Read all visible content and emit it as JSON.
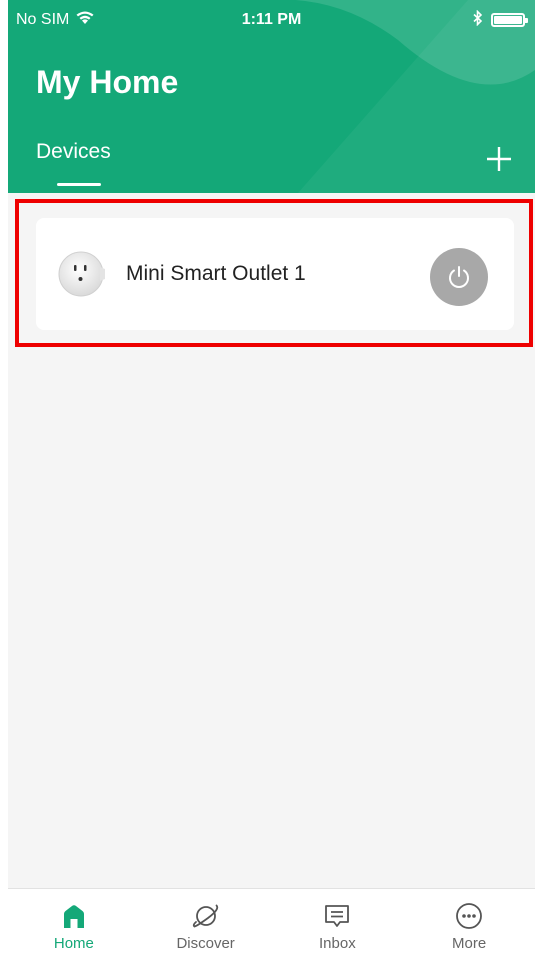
{
  "status_bar": {
    "carrier": "No SIM",
    "time": "1:11 PM",
    "bluetooth_icon": "bluetooth-icon",
    "battery_icon": "battery-icon",
    "wifi_icon": "wifi-icon"
  },
  "header": {
    "title": "My Home",
    "tabs": [
      {
        "label": "Devices",
        "active": true
      }
    ],
    "add_icon": "plus-icon"
  },
  "devices": [
    {
      "name": "Mini Smart Outlet 1",
      "thumbnail_icon": "smart-outlet-icon",
      "power_icon": "power-icon",
      "power_state": "off"
    }
  ],
  "tab_bar": {
    "items": [
      {
        "label": "Home",
        "icon": "home-icon",
        "active": true
      },
      {
        "label": "Discover",
        "icon": "planet-icon",
        "active": false
      },
      {
        "label": "Inbox",
        "icon": "message-icon",
        "active": false
      },
      {
        "label": "More",
        "icon": "more-icon",
        "active": false
      }
    ]
  },
  "colors": {
    "brand_green": "#14a878",
    "highlight_red": "#ee0000",
    "power_off_gray": "#a8a8a8",
    "background": "#f5f5f5"
  }
}
